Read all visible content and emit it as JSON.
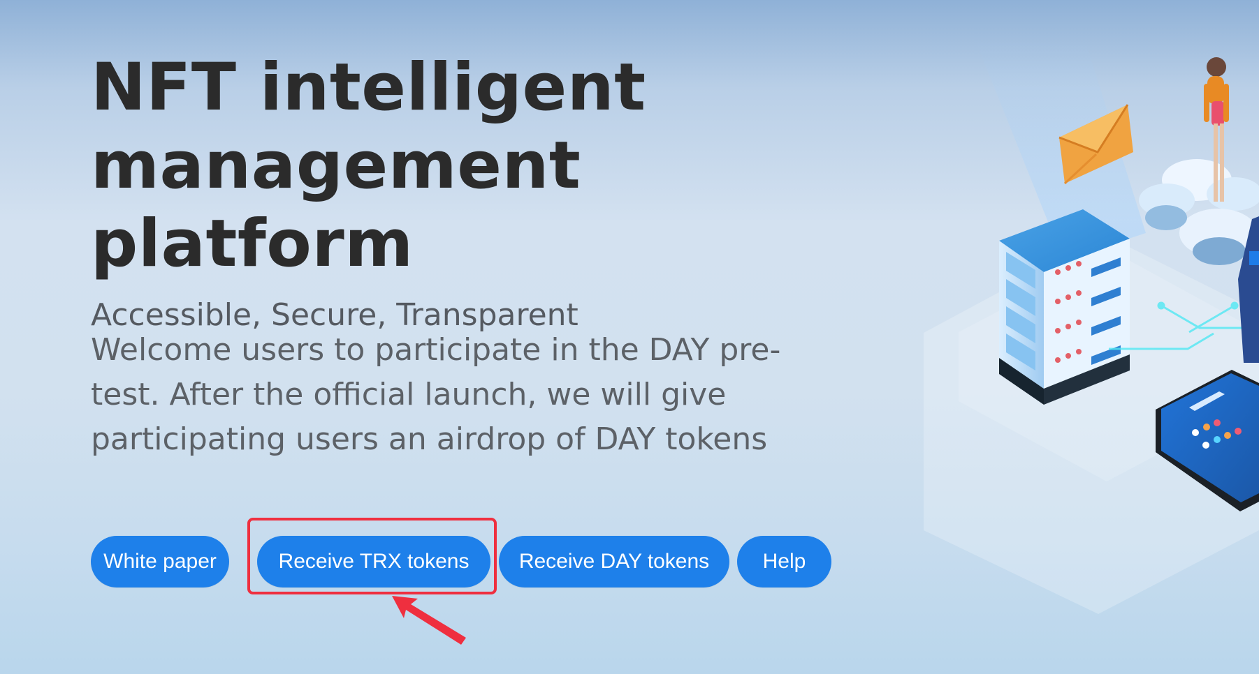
{
  "hero": {
    "title_line1": "NFT intelligent",
    "title_line2": "management platform",
    "subtitle": "Accessible, Secure, Transparent",
    "description": "Welcome users to participate in the DAY pre-test. After the official launch, we will give participating users an airdrop of DAY tokens"
  },
  "actions": {
    "white_paper": "White paper",
    "receive_trx": "Receive TRX tokens",
    "receive_day": "Receive DAY tokens",
    "help": "Help"
  },
  "colors": {
    "button": "#1e80ea",
    "highlight": "#ef2f3f"
  },
  "icons": {
    "server": "server-stack-icon",
    "phone": "mobile-phone-icon",
    "envelope": "envelope-icon",
    "person": "woman-figure-icon",
    "arrow": "red-arrow-icon"
  }
}
